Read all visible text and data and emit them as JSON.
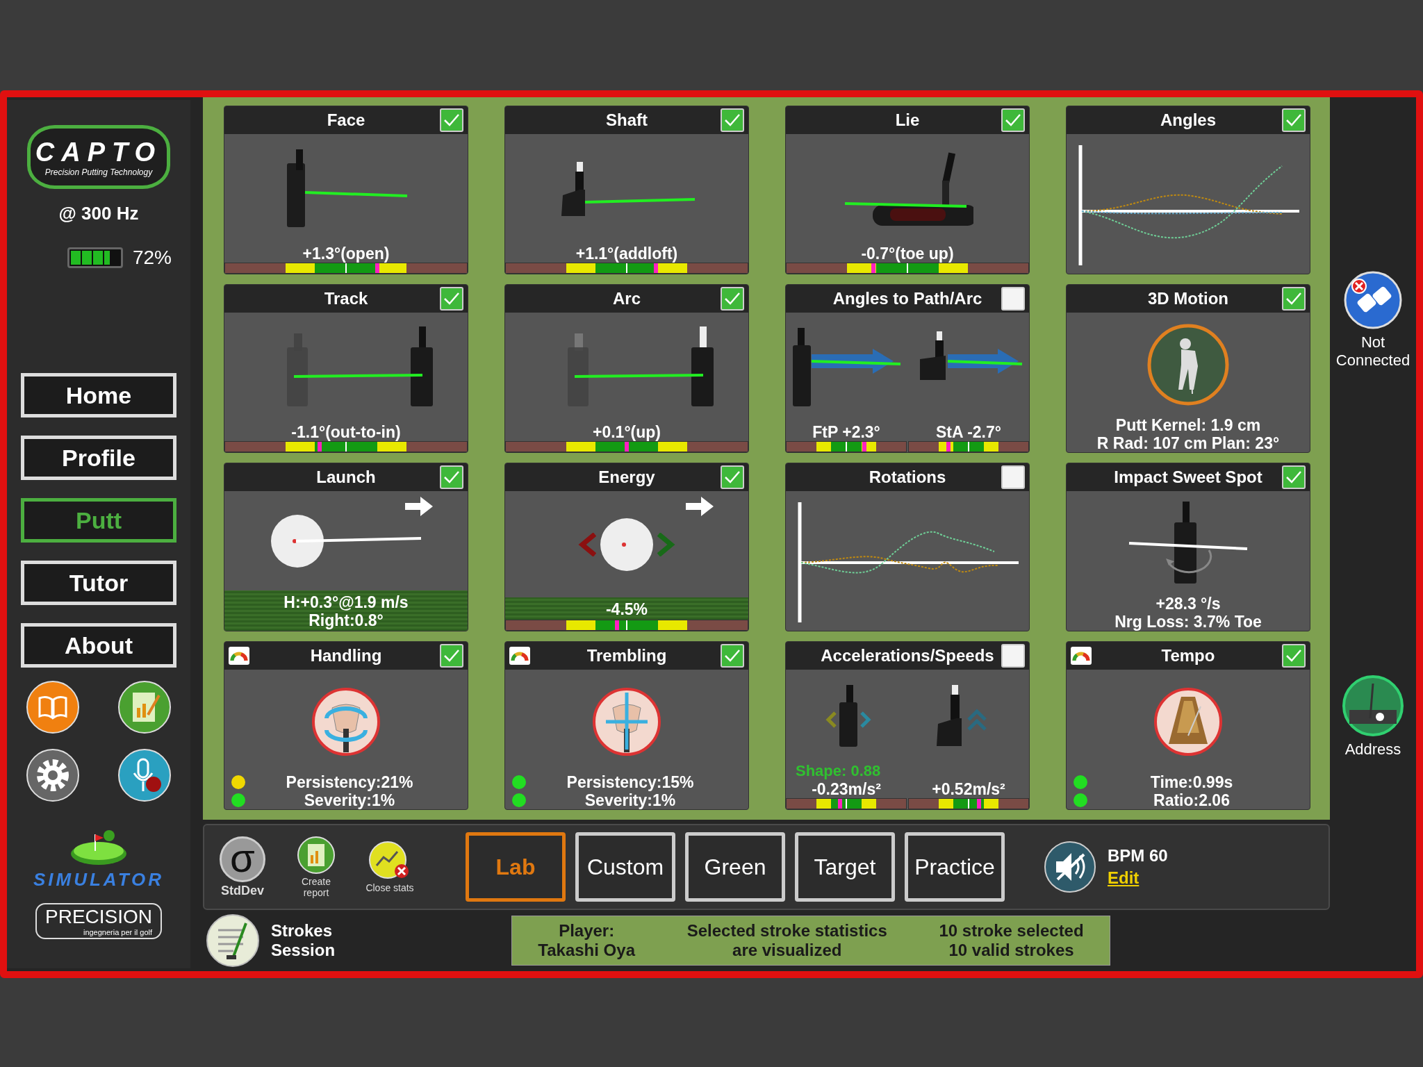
{
  "sidebar": {
    "logo_title": "CAPTO",
    "logo_subtitle": "Precision Putting Technology",
    "frequency": "@ 300 Hz",
    "battery": {
      "level": 0.8,
      "reading": "72%"
    },
    "nav": [
      {
        "label": "Home",
        "selected": false
      },
      {
        "label": "Profile",
        "selected": false
      },
      {
        "label": "Putt",
        "selected": true
      },
      {
        "label": "Tutor",
        "selected": false
      },
      {
        "label": "About",
        "selected": false
      }
    ],
    "simulator_label": "SIMULATOR",
    "brand": "PRECISION",
    "brand_tagline": "ingegneria per il golf"
  },
  "panels": [
    {
      "kind": "face",
      "title": "Face",
      "checked": true,
      "readouts": [
        "+1.3°(open)"
      ],
      "scale": {
        "level": 0.63
      }
    },
    {
      "kind": "shaft",
      "title": "Shaft",
      "checked": true,
      "readouts": [
        "+1.1°(addloft)"
      ],
      "scale": {
        "level": 0.62
      }
    },
    {
      "kind": "lie",
      "title": "Lie",
      "checked": true,
      "readouts": [
        "-0.7°(toe up)"
      ],
      "scale": {
        "level": 0.36
      }
    },
    {
      "kind": "angles",
      "title": "Angles",
      "checked": true
    },
    {
      "kind": "track",
      "title": "Track",
      "checked": true,
      "readouts": [
        "-1.1°(out-to-in)"
      ],
      "scale": {
        "level": 0.39
      }
    },
    {
      "kind": "arc",
      "title": "Arc",
      "checked": true,
      "readouts": [
        "+0.1°(up)"
      ],
      "scale": {
        "level": 0.5
      }
    },
    {
      "kind": "path-arc",
      "title": "Angles to Path/Arc",
      "checked": false,
      "split": [
        {
          "text": "FtP +2.3°",
          "level": 0.65
        },
        {
          "text": "StA -2.7°",
          "level": 0.33
        }
      ]
    },
    {
      "kind": "motion",
      "title": "3D Motion",
      "checked": true,
      "readouts": [
        "Putt Kernel: 1.9 cm",
        "R Rad: 107 cm    Plan: 23°"
      ]
    },
    {
      "kind": "launch",
      "title": "Launch",
      "checked": true,
      "readouts": [
        "H:+0.3°@1.9 m/s",
        "Right:0.8°"
      ]
    },
    {
      "kind": "energy",
      "title": "Energy",
      "checked": true,
      "readouts": [
        "-4.5%"
      ],
      "scale": {
        "level": 0.46
      }
    },
    {
      "kind": "rotations",
      "title": "Rotations",
      "checked": false
    },
    {
      "kind": "sweet-spot",
      "title": "Impact Sweet Spot",
      "checked": true,
      "readouts": [
        "+28.3 °/s",
        "Nrg Loss: 3.7% Toe"
      ]
    },
    {
      "kind": "handling",
      "title": "Handling",
      "checked": true,
      "gauge": true,
      "indicators": [
        {
          "text": "Persistency:21%",
          "color": "#f0d800"
        },
        {
          "text": "Severity:1%",
          "color": "#22dd22"
        }
      ]
    },
    {
      "kind": "trembling",
      "title": "Trembling",
      "checked": true,
      "gauge": true,
      "indicators": [
        {
          "text": "Persistency:15%",
          "color": "#22dd22"
        },
        {
          "text": "Severity:1%",
          "color": "#22dd22"
        }
      ]
    },
    {
      "kind": "accel",
      "title": "Accelerations/Speeds",
      "checked": false,
      "highlight": "Shape: 0.88",
      "split": [
        {
          "text": "-0.23m/s²",
          "level": 0.45
        },
        {
          "text": "+0.52m/s²",
          "level": 0.59
        }
      ]
    },
    {
      "kind": "tempo",
      "title": "Tempo",
      "checked": true,
      "gauge": true,
      "indicators": [
        {
          "text": "Time:0.99s",
          "color": "#22dd22"
        },
        {
          "text": "Ratio:2.06",
          "color": "#22dd22"
        }
      ]
    }
  ],
  "right_rail": {
    "connection": "Not Connected",
    "address": "Address"
  },
  "toolbar": {
    "stddev_symbol": "σ",
    "tools": [
      {
        "kind": "stddev",
        "label": "StdDev"
      },
      {
        "kind": "report",
        "label": "Create report"
      },
      {
        "kind": "close",
        "label": "Close stats"
      }
    ],
    "modes": [
      {
        "label": "Lab",
        "selected": true
      },
      {
        "label": "Custom",
        "selected": false
      },
      {
        "label": "Green",
        "selected": false
      },
      {
        "label": "Target",
        "selected": false
      },
      {
        "label": "Practice",
        "selected": false
      }
    ],
    "bpm": "BPM 60",
    "edit": "Edit"
  },
  "status": {
    "session": "Strokes Session",
    "columns": [
      [
        "Player:",
        "Takashi Oya"
      ],
      [
        "Selected stroke statistics",
        "are visualized"
      ],
      [
        "10 stroke selected",
        "10 valid strokes"
      ]
    ]
  }
}
